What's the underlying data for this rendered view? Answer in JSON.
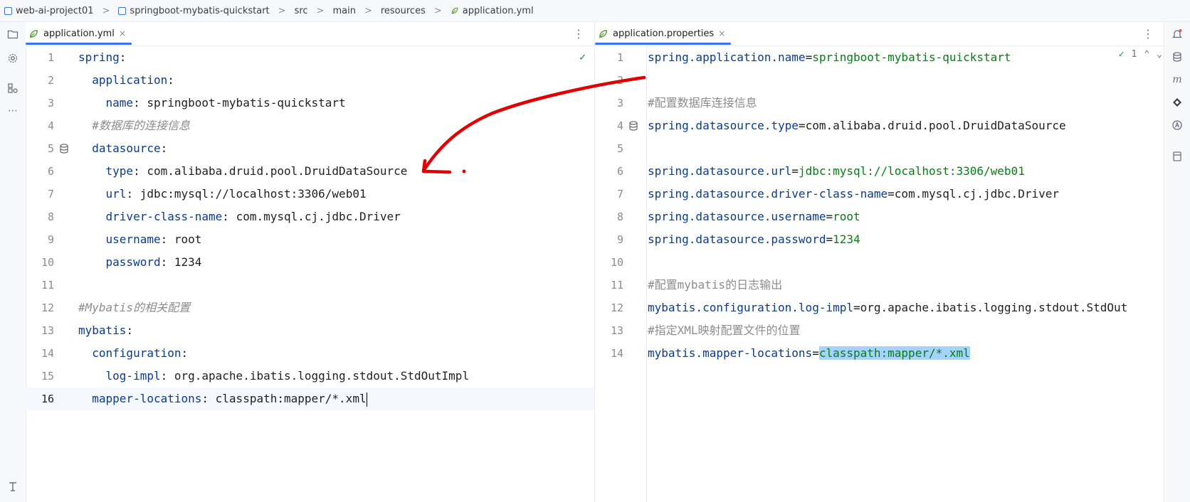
{
  "breadcrumb": [
    "web-ai-project01",
    "springboot-mybatis-quickstart",
    "src",
    "main",
    "resources",
    "application.yml"
  ],
  "left_tab": {
    "label": "application.yml",
    "close": "×"
  },
  "right_tab": {
    "label": "application.properties",
    "close": "×"
  },
  "right_inspection": {
    "count": "1"
  },
  "menu_glyph": "⋮",
  "left_lines": [
    {
      "num": "1",
      "key": "spring",
      "rest": ":",
      "indent": ""
    },
    {
      "num": "2",
      "key": "application",
      "rest": ":",
      "indent": "  "
    },
    {
      "num": "3",
      "key": "name",
      "rest": ": springboot-mybatis-quickstart",
      "indent": "    "
    },
    {
      "num": "4",
      "comment": "#数据库的连接信息",
      "indent": "  "
    },
    {
      "num": "5",
      "key": "datasource",
      "rest": ":",
      "indent": "  "
    },
    {
      "num": "6",
      "key": "type",
      "rest": ": com.alibaba.druid.pool.DruidDataSource",
      "indent": "    "
    },
    {
      "num": "7",
      "key": "url",
      "rest": ": jdbc:mysql://localhost:3306/web01",
      "indent": "    "
    },
    {
      "num": "8",
      "key": "driver-class-name",
      "rest": ": com.mysql.cj.jdbc.Driver",
      "indent": "    "
    },
    {
      "num": "9",
      "key": "username",
      "rest": ": root",
      "indent": "    "
    },
    {
      "num": "10",
      "key": "password",
      "rest": ": 1234",
      "indent": "    "
    },
    {
      "num": "11",
      "indent": ""
    },
    {
      "num": "12",
      "comment": "#Mybatis的相关配置",
      "indent": ""
    },
    {
      "num": "13",
      "key": "mybatis",
      "rest": ":",
      "indent": ""
    },
    {
      "num": "14",
      "key": "configuration",
      "rest": ":",
      "indent": "  "
    },
    {
      "num": "15",
      "key": "log-impl",
      "rest": ": org.apache.ibatis.logging.stdout.StdOutImpl",
      "indent": "    "
    },
    {
      "num": "16",
      "key": "mapper-locations",
      "rest": ": classpath:mapper/*.xml",
      "indent": "  "
    }
  ],
  "right_lines": [
    {
      "num": "1",
      "key": "spring.application.name",
      "val": "springboot-mybatis-quickstart"
    },
    {
      "num": "2"
    },
    {
      "num": "3",
      "comment": "#配置数据库连接信息"
    },
    {
      "num": "4",
      "key": "spring.datasource.type",
      "val": "com.alibaba.druid.pool.DruidDataSource"
    },
    {
      "num": "5"
    },
    {
      "num": "6",
      "key": "spring.datasource.url",
      "val": "jdbc:mysql://localhost:3306/web01"
    },
    {
      "num": "7",
      "key": "spring.datasource.driver-class-name",
      "val": "com.mysql.cj.jdbc.Driver"
    },
    {
      "num": "8",
      "key": "spring.datasource.username",
      "val": "root"
    },
    {
      "num": "9",
      "key": "spring.datasource.password",
      "val": "1234"
    },
    {
      "num": "10"
    },
    {
      "num": "11",
      "comment": "#配置mybatis的日志输出"
    },
    {
      "num": "12",
      "key": "mybatis.configuration.log-impl",
      "val": "org.apache.ibatis.logging.stdout.StdOut"
    },
    {
      "num": "13",
      "comment": "#指定XML映射配置文件的位置"
    },
    {
      "num": "14",
      "key": "mybatis.mapper-locations",
      "val": "classpath:mapper/*.xml"
    }
  ],
  "colors": {
    "accent": "#3574f0",
    "key": "#0c3a8c",
    "value_green": "#067d17",
    "comment": "#8c8c8c",
    "annotation": "#e00000"
  }
}
